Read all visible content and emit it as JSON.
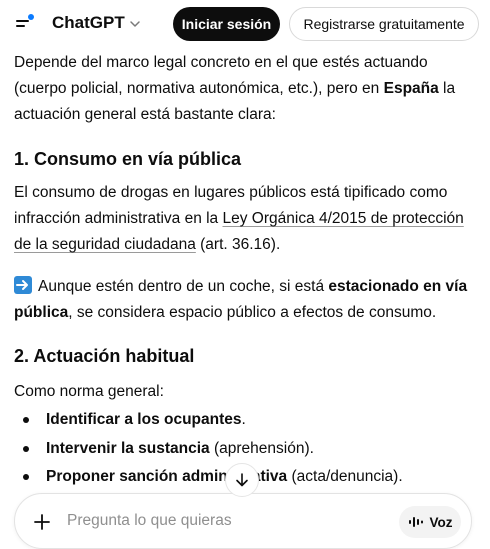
{
  "header": {
    "brand": "ChatGPT",
    "login_label": "Iniciar sesión",
    "signup_label": "Registrarse gratuitamente"
  },
  "message": {
    "intro_1": "Depende del marco legal concreto en el que estés actuando (cuerpo policial, normativa autonómica, etc.), pero en ",
    "intro_bold": "España",
    "intro_2": " la actuación general está bastante clara:",
    "section1_heading": "1. Consumo en vía pública",
    "p2_1": "El consumo de drogas en lugares públicos está tipificado como infracción administrativa en la ",
    "p2_link": "Ley Orgánica 4/2015 de protección de la seguridad ciudadana",
    "p2_2": " (art. 36.16).",
    "p3_1": "Aunque estén dentro de un coche, si está ",
    "p3_bold": "estacionado en vía pública",
    "p3_2": ", se considera espacio público a efectos de consumo.",
    "section2_heading": "2. Actuación habitual",
    "p4": "Como norma general:",
    "bullets": [
      {
        "bold": "Identificar a los ocupantes",
        "rest": "."
      },
      {
        "bold": "Intervenir la sustancia",
        "rest": " (aprehensión)."
      },
      {
        "bold": "Proponer sanción administrativa",
        "rest": " (acta/denuncia)."
      }
    ]
  },
  "composer": {
    "placeholder": "Pregunta lo que quieras",
    "voice_label": "Voz"
  },
  "icons": {
    "menu": "menu-icon",
    "chevron": "chevron-down-icon",
    "arrow_emoji": "right-arrow-emoji-icon",
    "scroll_down": "arrow-down-icon",
    "plus": "plus-icon",
    "voice": "voice-waveform-icon"
  },
  "colors": {
    "primary_button": "#0d0d0d",
    "accent_dot": "#0b7bff",
    "emoji_blue": "#2f8ad6"
  }
}
